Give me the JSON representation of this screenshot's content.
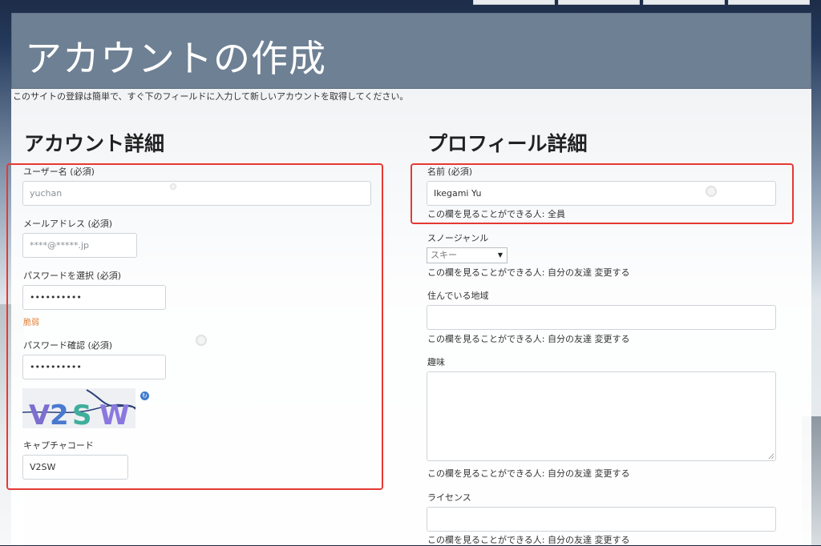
{
  "page": {
    "title": "アカウントの作成",
    "intro": "このサイトの登録は簡単で、すぐ下のフィールドに入力して新しいアカウントを取得してください。"
  },
  "account": {
    "heading": "アカウント詳細",
    "username_label": "ユーザー名 (必須)",
    "username_value": "yuchan",
    "email_label": "メールアドレス (必須)",
    "email_value": "****@*****.jp",
    "password_label": "パスワードを選択 (必須)",
    "password_value": "••••••••••",
    "password_strength": "脆弱",
    "password_confirm_label": "パスワード確認 (必須)",
    "password_confirm_value": "••••••••••",
    "captcha_text": "V2SW",
    "captcha_label": "キャプチャコード",
    "captcha_value": "V2SW"
  },
  "profile": {
    "heading": "プロフィール詳細",
    "name_label": "名前 (必須)",
    "name_value": "Ikegami Yu",
    "name_visibility": "この欄を見ることができる人: 全員",
    "snow_genre_label": "スノージャンル",
    "snow_genre_selected": "スキー",
    "snow_genre_visibility": "この欄を見ることができる人: 自分の友達 変更する",
    "region_label": "住んでいる地域",
    "region_visibility": "この欄を見ることができる人: 自分の友達 変更する",
    "hobby_label": "趣味",
    "hobby_visibility": "この欄を見ることができる人: 自分の友達 変更する",
    "license_label": "ライセンス",
    "license_visibility": "この欄を見ることができる人: 自分の友達 変更する"
  },
  "colors": {
    "header_bg": "#6e8093",
    "highlight_box": "#e53935",
    "weak_password": "#e0813a"
  }
}
